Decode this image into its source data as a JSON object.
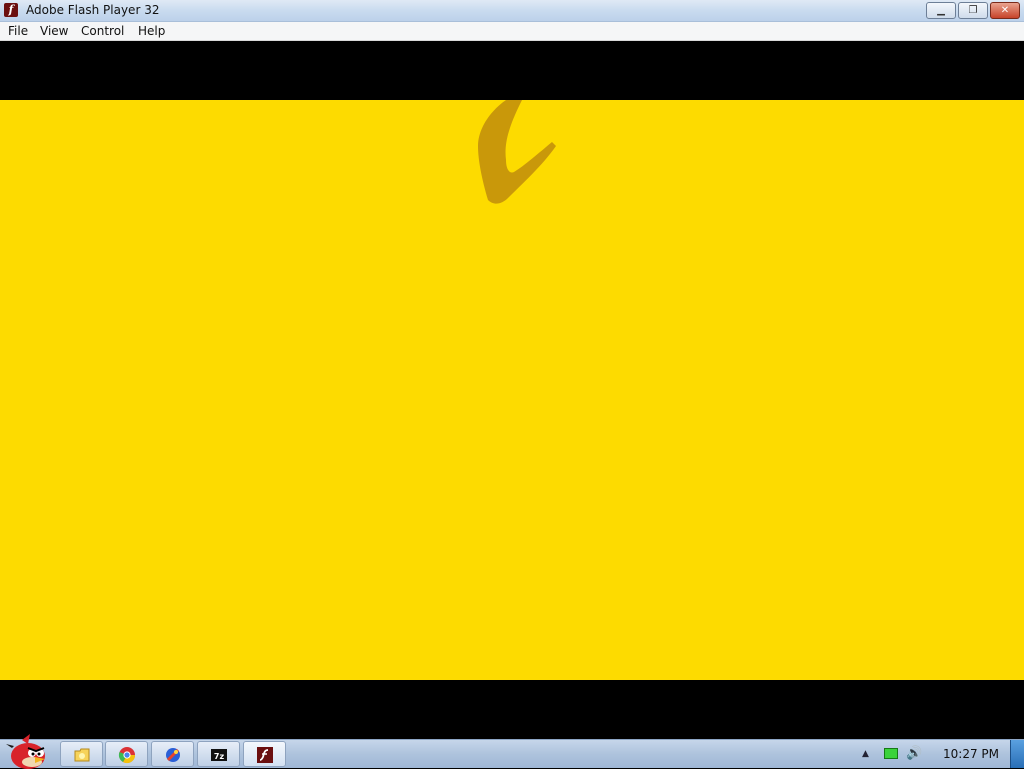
{
  "window": {
    "title": "Adobe Flash Player 32",
    "app_icon": "flash-icon",
    "controls": [
      "minimize",
      "restore",
      "close"
    ]
  },
  "menu": [
    "File",
    "View",
    "Control",
    "Help"
  ],
  "stage": {
    "background": "#000000",
    "content_color": "#fddb00",
    "brush_color": "#c9980a"
  },
  "taskbar": {
    "start_icon": "angry-bird-icon",
    "pinned": [
      "explorer-folder-icon",
      "chrome-icon",
      "flash-app-icon",
      "7zip-icon",
      "flash-player-icon"
    ],
    "tray": {
      "arrow": "▲",
      "network_icon": "network-icon",
      "volume_icon": "volume-icon",
      "time": "10:27 PM"
    }
  }
}
